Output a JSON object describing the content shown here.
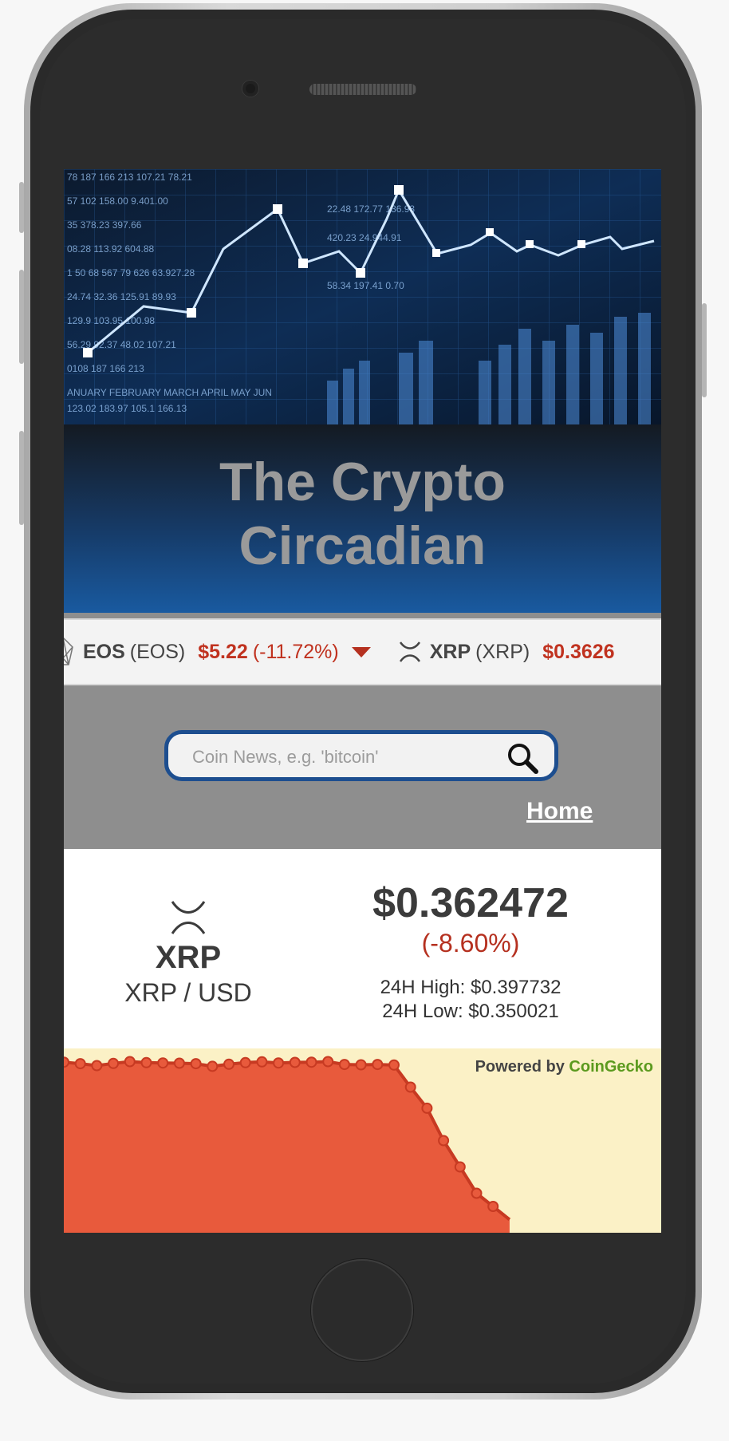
{
  "site": {
    "title_line1": "The Crypto",
    "title_line2": "Circadian"
  },
  "ticker": {
    "items": [
      {
        "name": "EOS",
        "code": "(EOS)",
        "price": "$5.22",
        "change": "(-11.72%)",
        "direction": "down",
        "icon": "eos-icon"
      },
      {
        "name": "XRP",
        "code": "(XRP)",
        "price": "$0.3626",
        "change": "",
        "direction": "down",
        "icon": "xrp-icon"
      }
    ]
  },
  "search": {
    "placeholder": "Coin News, e.g. 'bitcoin'"
  },
  "nav": {
    "home_label": "Home"
  },
  "coin": {
    "symbol": "XRP",
    "pair": "XRP / USD",
    "price": "$0.362472",
    "change": "(-8.60%)",
    "high": "24H High: $0.397732",
    "low": "24H Low: $0.350021"
  },
  "attribution": {
    "prefix": "Powered by",
    "brand": "CoinGecko"
  },
  "colors": {
    "accent_blue": "#1d4e8f",
    "negative": "#c0321f",
    "chart_fill": "#e85a3c",
    "chart_line": "#c73a22",
    "chart_bg": "#fbf1c6",
    "brand_green": "#5b9a1e"
  },
  "chart_data": {
    "type": "area",
    "x": [
      0,
      1,
      2,
      3,
      4,
      5,
      6,
      7,
      8,
      9,
      10,
      11,
      12,
      13,
      14,
      15,
      16,
      17,
      18,
      19,
      20,
      21,
      22,
      23,
      24,
      25,
      26,
      27
    ],
    "values": [
      0.3998,
      0.3992,
      0.3985,
      0.3993,
      0.4,
      0.3996,
      0.3995,
      0.3994,
      0.3992,
      0.3982,
      0.399,
      0.3996,
      0.3999,
      0.3995,
      0.3997,
      0.3998,
      0.4,
      0.3989,
      0.3988,
      0.3989,
      0.3987,
      0.3903,
      0.3823,
      0.37,
      0.36,
      0.35,
      0.345,
      0.34
    ],
    "ylim": [
      0.335,
      0.405
    ]
  }
}
